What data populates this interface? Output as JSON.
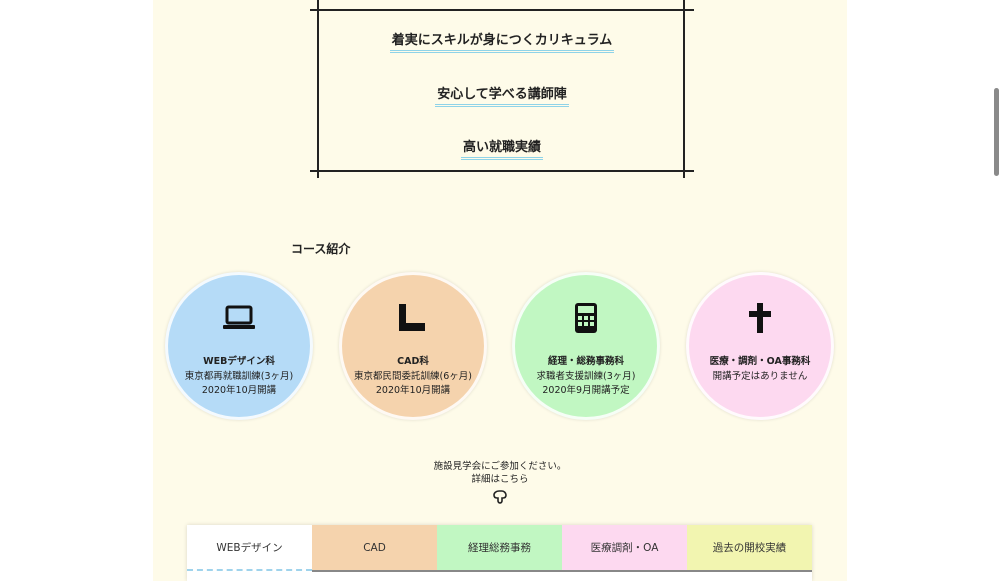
{
  "features": [
    "着実にスキルが身につくカリキュラム",
    "安心して学べる講師陣",
    "高い就職実績"
  ],
  "courses_section": {
    "title": "コース紹介",
    "courses": [
      {
        "icon": "laptop-icon",
        "color": "#b5dbf7",
        "name": "WEBデザイン科",
        "line1": "東京都再就職訓練(3ヶ月)",
        "line2": "2020年10月開講"
      },
      {
        "icon": "ruler-icon",
        "color": "#f5d3ad",
        "name": "CAD科",
        "line1": "東京都民間委託訓練(6ヶ月)",
        "line2": "2020年10月開講"
      },
      {
        "icon": "calculator-icon",
        "color": "#c1f7c2",
        "name": "経理・総務事務科",
        "line1": "求職者支援訓練(3ヶ月)",
        "line2": "2020年9月開講予定"
      },
      {
        "icon": "cross-icon",
        "color": "#fdd9f0",
        "name": "医療・調剤・OA事務科",
        "line1": "開講予定はありません",
        "line2": ""
      }
    ]
  },
  "visit": {
    "line1": "施設見学会にご参加ください。",
    "line2": "詳細はこちら",
    "icon": "pointing-hand-icon"
  },
  "tabs": [
    {
      "label": "WEBデザイン",
      "color": "#ffffff",
      "active": true
    },
    {
      "label": "CAD",
      "color": "#f5d3ad",
      "active": false
    },
    {
      "label": "経理総務事務",
      "color": "#c1f7c2",
      "active": false
    },
    {
      "label": "医療調剤・OA",
      "color": "#fdd9f0",
      "active": false
    },
    {
      "label": "過去の開校実績",
      "color": "#f2f5b0",
      "active": false
    }
  ],
  "colors": {
    "page_bg": "#fefbe9",
    "accent_underline": "#8fd3e8"
  }
}
